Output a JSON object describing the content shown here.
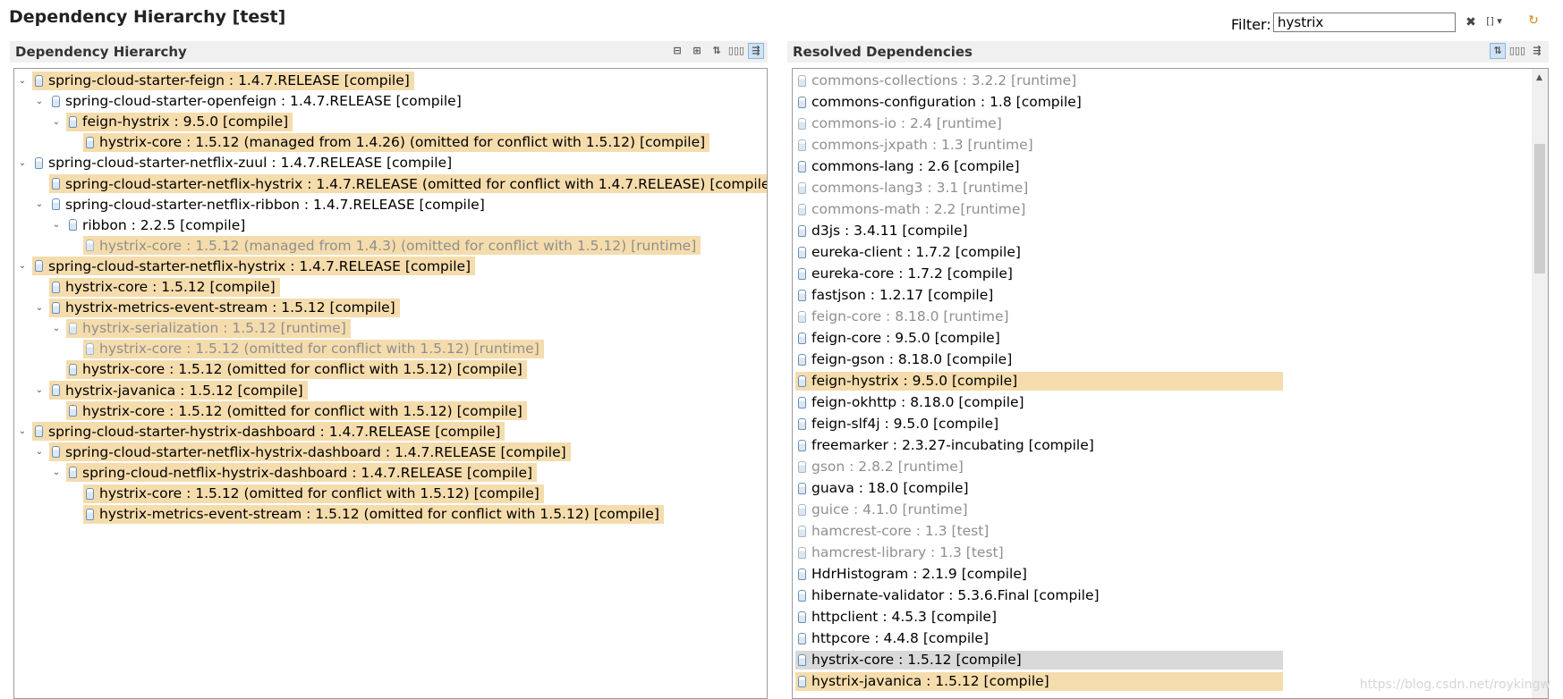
{
  "title": "Dependency Hierarchy [test]",
  "filter": {
    "label": "Filter:",
    "value": "hystrix"
  },
  "left_panel": {
    "title": "Dependency Hierarchy",
    "rows": [
      {
        "t": "spring-cloud-starter-feign : 1.4.7.RELEASE [compile]",
        "d": 0,
        "s": "open",
        "h": true
      },
      {
        "t": "spring-cloud-starter-openfeign : 1.4.7.RELEASE [compile]",
        "d": 1,
        "s": "open",
        "h": false
      },
      {
        "t": "feign-hystrix : 9.5.0 [compile]",
        "d": 2,
        "s": "open",
        "h": true
      },
      {
        "t": "hystrix-core : 1.5.12 (managed from 1.4.26) (omitted for conflict with 1.5.12) [compile]",
        "d": 3,
        "s": "none",
        "h": true
      },
      {
        "t": "spring-cloud-starter-netflix-zuul : 1.4.7.RELEASE [compile]",
        "d": 0,
        "s": "open",
        "h": false
      },
      {
        "t": "spring-cloud-starter-netflix-hystrix : 1.4.7.RELEASE (omitted for conflict with 1.4.7.RELEASE) [compile]",
        "d": 1,
        "s": "none",
        "h": true
      },
      {
        "t": "spring-cloud-starter-netflix-ribbon : 1.4.7.RELEASE [compile]",
        "d": 1,
        "s": "open",
        "h": false
      },
      {
        "t": "ribbon : 2.2.5 [compile]",
        "d": 2,
        "s": "open",
        "h": false
      },
      {
        "t": "hystrix-core : 1.5.12 (managed from 1.4.3) (omitted for conflict with 1.5.12) [runtime]",
        "d": 3,
        "s": "none",
        "h": true,
        "g": true
      },
      {
        "t": "spring-cloud-starter-netflix-hystrix : 1.4.7.RELEASE [compile]",
        "d": 0,
        "s": "open",
        "h": true
      },
      {
        "t": "hystrix-core : 1.5.12 [compile]",
        "d": 1,
        "s": "none",
        "h": true
      },
      {
        "t": "hystrix-metrics-event-stream : 1.5.12 [compile]",
        "d": 1,
        "s": "open",
        "h": true
      },
      {
        "t": "hystrix-serialization : 1.5.12 [runtime]",
        "d": 2,
        "s": "open",
        "h": true,
        "g": true
      },
      {
        "t": "hystrix-core : 1.5.12 (omitted for conflict with 1.5.12) [runtime]",
        "d": 3,
        "s": "none",
        "h": true,
        "g": true
      },
      {
        "t": "hystrix-core : 1.5.12 (omitted for conflict with 1.5.12) [compile]",
        "d": 2,
        "s": "none",
        "h": true
      },
      {
        "t": "hystrix-javanica : 1.5.12 [compile]",
        "d": 1,
        "s": "open",
        "h": true
      },
      {
        "t": "hystrix-core : 1.5.12 (omitted for conflict with 1.5.12) [compile]",
        "d": 2,
        "s": "none",
        "h": true
      },
      {
        "t": "spring-cloud-starter-hystrix-dashboard : 1.4.7.RELEASE [compile]",
        "d": 0,
        "s": "open",
        "h": true
      },
      {
        "t": "spring-cloud-starter-netflix-hystrix-dashboard : 1.4.7.RELEASE [compile]",
        "d": 1,
        "s": "open",
        "h": true
      },
      {
        "t": "spring-cloud-netflix-hystrix-dashboard : 1.4.7.RELEASE [compile]",
        "d": 2,
        "s": "open",
        "h": true
      },
      {
        "t": "hystrix-core : 1.5.12 (omitted for conflict with 1.5.12) [compile]",
        "d": 3,
        "s": "none",
        "h": true
      },
      {
        "t": "hystrix-metrics-event-stream : 1.5.12 (omitted for conflict with 1.5.12) [compile]",
        "d": 3,
        "s": "none",
        "h": true
      }
    ]
  },
  "right_panel": {
    "title": "Resolved Dependencies",
    "rows": [
      {
        "t": "commons-collections : 3.2.2 [runtime]",
        "g": true
      },
      {
        "t": "commons-configuration : 1.8 [compile]"
      },
      {
        "t": "commons-io : 2.4 [runtime]",
        "g": true
      },
      {
        "t": "commons-jxpath : 1.3 [runtime]",
        "g": true
      },
      {
        "t": "commons-lang : 2.6 [compile]"
      },
      {
        "t": "commons-lang3 : 3.1 [runtime]",
        "g": true
      },
      {
        "t": "commons-math : 2.2 [runtime]",
        "g": true
      },
      {
        "t": "d3js : 3.4.11 [compile]"
      },
      {
        "t": "eureka-client : 1.7.2 [compile]"
      },
      {
        "t": "eureka-core : 1.7.2 [compile]"
      },
      {
        "t": "fastjson : 1.2.17 [compile]"
      },
      {
        "t": "feign-core : 8.18.0 [runtime]",
        "g": true
      },
      {
        "t": "feign-core : 9.5.0 [compile]"
      },
      {
        "t": "feign-gson : 8.18.0 [compile]"
      },
      {
        "t": "feign-hystrix : 9.5.0 [compile]",
        "h": true
      },
      {
        "t": "feign-okhttp : 8.18.0 [compile]"
      },
      {
        "t": "feign-slf4j : 9.5.0 [compile]"
      },
      {
        "t": "freemarker : 2.3.27-incubating [compile]"
      },
      {
        "t": "gson : 2.8.2 [runtime]",
        "g": true
      },
      {
        "t": "guava : 18.0 [compile]"
      },
      {
        "t": "guice : 4.1.0 [runtime]",
        "g": true
      },
      {
        "t": "hamcrest-core : 1.3 [test]",
        "g": true
      },
      {
        "t": "hamcrest-library : 1.3 [test]",
        "g": true
      },
      {
        "t": "HdrHistogram : 2.1.9 [compile]"
      },
      {
        "t": "hibernate-validator : 5.3.6.Final [compile]"
      },
      {
        "t": "httpclient : 4.5.3 [compile]"
      },
      {
        "t": "httpcore : 4.4.8 [compile]"
      },
      {
        "t": "hystrix-core : 1.5.12 [compile]",
        "sel": true
      },
      {
        "t": "hystrix-javanica : 1.5.12 [compile]",
        "h": true
      }
    ]
  },
  "watermark": "https://blog.csdn.net/roykingw"
}
